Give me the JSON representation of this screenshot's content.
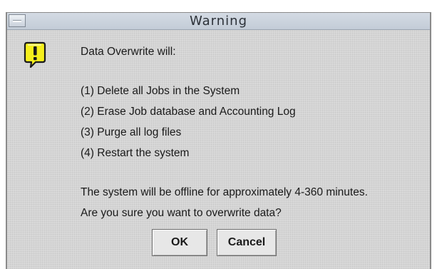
{
  "window": {
    "title": "Warning"
  },
  "icon": {
    "name": "warning-icon",
    "glyph": "!",
    "color": "#f5ef1c"
  },
  "message": {
    "intro": "Data Overwrite will:",
    "items": [
      "(1) Delete all Jobs in the System",
      "(2) Erase Job database and Accounting Log",
      "(3) Purge all log files",
      "(4) Restart the system"
    ],
    "note": "The system will be offline for approximately 4-360 minutes.",
    "question": "Are you sure you want to overwrite data?"
  },
  "buttons": {
    "ok_label": "OK",
    "cancel_label": "Cancel"
  }
}
